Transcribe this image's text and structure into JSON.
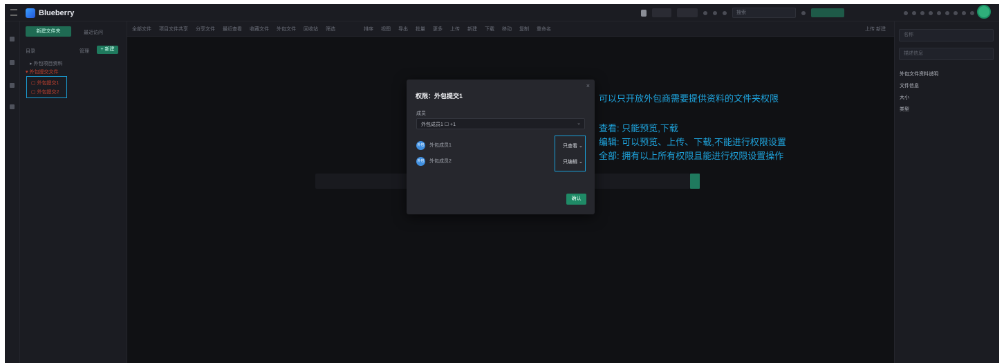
{
  "app": {
    "name": "Blueberry"
  },
  "topbar": {
    "search_placeholder": "搜索"
  },
  "sidebar": {
    "new_button": "新建文件夹",
    "recent_label": "最近访问",
    "section_label": "目录",
    "manage_label": "管理",
    "add_button": "+ 新建",
    "tree": {
      "root": "▸ 外包项目资料",
      "group": "▾ 外包提交文件",
      "folder1": "▢ 外包提交1",
      "folder2": "▢ 外包提交2"
    }
  },
  "strip": {
    "items": [
      "全部文件",
      "项目文件共享",
      "分享文件",
      "最近查看",
      "收藏文件",
      "外包文件",
      "回收站",
      "筛选",
      "排序",
      "视图",
      "导出",
      "批量",
      "更多",
      "上传",
      "新建",
      "下载",
      "移动",
      "复制",
      "重命名"
    ],
    "right_label": "上传  新建"
  },
  "right_panel": {
    "input1": "名称",
    "input2": "描述信息",
    "line1": "外包文件资料说明",
    "line2": "文件信息",
    "line3": "大小",
    "line4": "类型"
  },
  "modal": {
    "title": "权限：外包提交1",
    "close": "×",
    "member_label": "成员",
    "select_value": "外包成员1 ☐  +1",
    "select_arrow": "⌄",
    "users": [
      {
        "initials": "外包",
        "name": "外包成员1",
        "permission": "只查看 ⌄"
      },
      {
        "initials": "外包",
        "name": "外包成员2",
        "permission": "只编辑 ⌄"
      }
    ],
    "ok_button": "确认"
  },
  "annotations": {
    "line1": "可以只开放外包商需要提供资料的文件夹权限",
    "line2": "查看: 只能预览,下载",
    "line3": "编辑: 可以预览、上传、下载,不能进行权限设置",
    "line4": "全部: 拥有以上所有权限且能进行权限设置操作"
  },
  "colors": {
    "accent": "#1f7a5e",
    "annotation": "#1ea3dc",
    "highlight": "#1aa0d8"
  }
}
